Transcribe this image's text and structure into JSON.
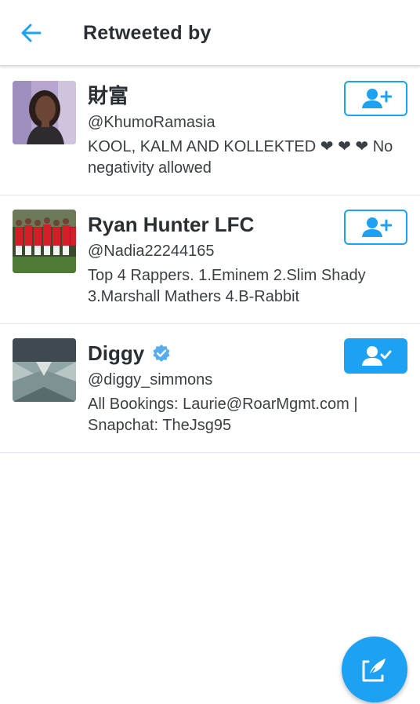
{
  "header": {
    "title": "Retweeted by",
    "back_icon": "arrow-left-icon",
    "accent_color": "#1da1f2"
  },
  "users": [
    {
      "name": "財富",
      "handle": "@KhumoRamasia",
      "bio": "KOOL, KALM AND KOLLEKTED ❤ ❤ ❤  No negativity allowed",
      "verified": false,
      "follow_state": "not-following",
      "follow_icon": "add-user-icon"
    },
    {
      "name": "Ryan Hunter LFC",
      "handle": "@Nadia22244165",
      "bio": "Top 4 Rappers. 1.Eminem 2.Slim Shady 3.Marshall Mathers 4.B-Rabbit",
      "verified": false,
      "follow_state": "not-following",
      "follow_icon": "add-user-icon"
    },
    {
      "name": "Diggy",
      "handle": "@diggy_simmons",
      "bio": "All Bookings: Laurie@RoarMgmt.com | Snapchat: TheJsg95",
      "verified": true,
      "follow_state": "following",
      "follow_icon": "user-check-icon"
    }
  ],
  "fab": {
    "icon": "compose-tweet-icon"
  }
}
